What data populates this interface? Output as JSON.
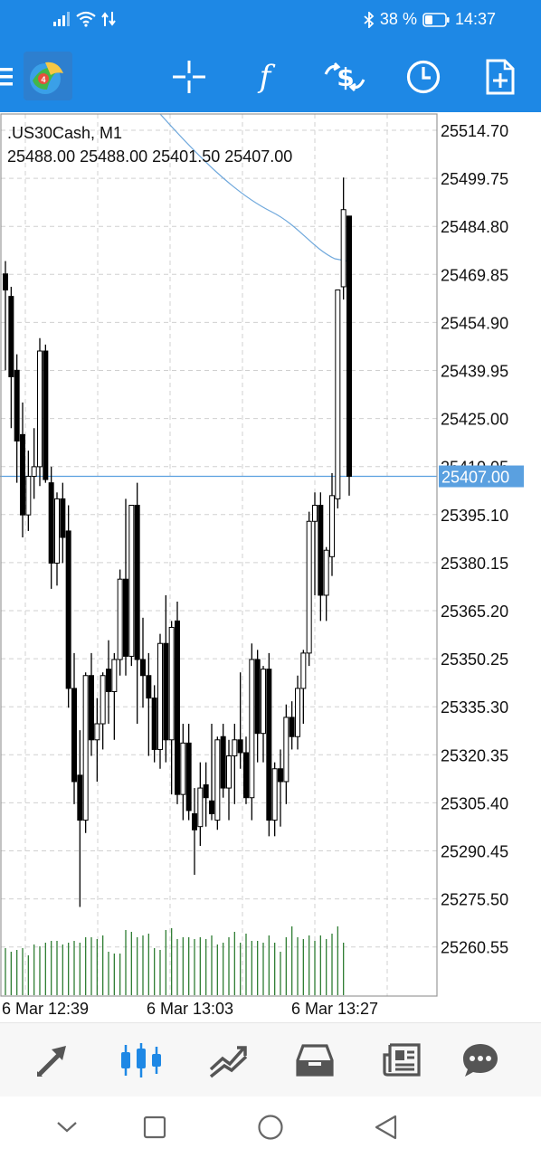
{
  "status_bar": {
    "battery_percent": "38 %",
    "battery_level": 0.38,
    "time": "14:37"
  },
  "toolbar": {
    "buttons": [
      {
        "name": "menu-icon"
      },
      {
        "name": "app-logo"
      },
      {
        "name": "crosshair-icon"
      },
      {
        "name": "indicators-icon"
      },
      {
        "name": "trade-icon"
      },
      {
        "name": "timeframe-clock-icon"
      },
      {
        "name": "new-object-icon"
      }
    ]
  },
  "chart": {
    "symbol_text": ".US30Cash, M1",
    "ohlc_text": "25488.00 25488.00 25401.50 25407.00",
    "current_price": "25407.00",
    "colors": {
      "grid": "#d0d0d0",
      "candle": "#000000",
      "volume": "#2e7d32",
      "price_line": "#5aa0e0",
      "ma_line": "#6fa8dc",
      "price_tag_bg": "#5aa0e0"
    }
  },
  "chart_data": {
    "type": "candlestick",
    "y_axis_ticks": [
      "25514.70",
      "25499.75",
      "25484.80",
      "25469.85",
      "25454.90",
      "25439.95",
      "25425.00",
      "25410.05",
      "25395.10",
      "25380.15",
      "25365.20",
      "25350.25",
      "25335.30",
      "25320.35",
      "25305.40",
      "25290.45",
      "25275.50",
      "25260.55"
    ],
    "x_axis_ticks": [
      "6 Mar 12:39",
      "6 Mar 13:03",
      "6 Mar 13:27"
    ],
    "ylim": [
      25254.0,
      25518.0
    ],
    "current_price": 25407.0,
    "grid": true,
    "candles": [
      [
        25470,
        25474,
        25440,
        25465
      ],
      [
        25463,
        25466,
        25422,
        25438
      ],
      [
        25440,
        25445,
        25405,
        25418
      ],
      [
        25420,
        25430,
        25388,
        25395
      ],
      [
        25395,
        25415,
        25390,
        25407
      ],
      [
        25407,
        25422,
        25400,
        25410
      ],
      [
        25410,
        25450,
        25404,
        25446
      ],
      [
        25446,
        25448,
        25405,
        25406
      ],
      [
        25405,
        25410,
        25372,
        25380
      ],
      [
        25380,
        25402,
        25373,
        25400
      ],
      [
        25400,
        25405,
        25380,
        25388
      ],
      [
        25390,
        25398,
        25335,
        25341
      ],
      [
        25341,
        25352,
        25305,
        25312
      ],
      [
        25314,
        25328,
        25273,
        25300
      ],
      [
        25300,
        25346,
        25296,
        25345
      ],
      [
        25345,
        25352,
        25320,
        25325
      ],
      [
        25325,
        25338,
        25312,
        25330
      ],
      [
        25330,
        25346,
        25322,
        25345
      ],
      [
        25347,
        25356,
        25330,
        25340
      ],
      [
        25340,
        25352,
        25325,
        25350
      ],
      [
        25350,
        25378,
        25345,
        25375
      ],
      [
        25375,
        25400,
        25345,
        25351
      ],
      [
        25351,
        25398,
        25348,
        25398
      ],
      [
        25398,
        25405,
        25330,
        25350
      ],
      [
        25350,
        25363,
        25335,
        25345
      ],
      [
        25345,
        25352,
        25320,
        25338
      ],
      [
        25338,
        25342,
        25318,
        25322
      ],
      [
        25322,
        25358,
        25316,
        25355
      ],
      [
        25355,
        25370,
        25318,
        25325
      ],
      [
        25325,
        25362,
        25308,
        25360
      ],
      [
        25362,
        25368,
        25305,
        25308
      ],
      [
        25308,
        25330,
        25300,
        25324
      ],
      [
        25324,
        25330,
        25300,
        25303
      ],
      [
        25302,
        25310,
        25283,
        25297
      ],
      [
        25298,
        25318,
        25292,
        25310
      ],
      [
        25311,
        25318,
        25298,
        25307
      ],
      [
        25306,
        25330,
        25300,
        25302
      ],
      [
        25300,
        25326,
        25297,
        25325
      ],
      [
        25326,
        25330,
        25307,
        25310
      ],
      [
        25310,
        25325,
        25300,
        25320
      ],
      [
        25320,
        25330,
        25305,
        25325
      ],
      [
        25325,
        25346,
        25316,
        25321
      ],
      [
        25321,
        25326,
        25305,
        25307
      ],
      [
        25307,
        25355,
        25300,
        25350
      ],
      [
        25350,
        25353,
        25318,
        25327
      ],
      [
        25327,
        25348,
        25318,
        25347
      ],
      [
        25347,
        25352,
        25295,
        25300
      ],
      [
        25300,
        25318,
        25295,
        25316
      ],
      [
        25316,
        25322,
        25298,
        25312
      ],
      [
        25312,
        25336,
        25305,
        25332
      ],
      [
        25332,
        25337,
        25322,
        25326
      ],
      [
        25326,
        25345,
        25322,
        25341
      ],
      [
        25341,
        25353,
        25330,
        25352
      ],
      [
        25352,
        25396,
        25348,
        25393
      ],
      [
        25393,
        25402,
        25370,
        25398
      ],
      [
        25398,
        25402,
        25362,
        25370
      ],
      [
        25370,
        25385,
        25362,
        25384
      ],
      [
        25382,
        25408,
        25376,
        25401
      ],
      [
        25400,
        25440,
        25397,
        25465
      ],
      [
        25466,
        25500,
        25462,
        25490
      ],
      [
        25488,
        25488,
        25401,
        25407
      ]
    ],
    "volumes": [
      26,
      24,
      25,
      26,
      22,
      28,
      27,
      29,
      30,
      30,
      28,
      29,
      30,
      29,
      32,
      32,
      31,
      33,
      24,
      23,
      23,
      36,
      35,
      32,
      33,
      34,
      26,
      25,
      36,
      37,
      31,
      32,
      32,
      31,
      32,
      31,
      33,
      28,
      29,
      32,
      35,
      29,
      34,
      30,
      30,
      29,
      33,
      29,
      24,
      32,
      38,
      32,
      31,
      33,
      30,
      33,
      31,
      34,
      38,
      29
    ]
  },
  "bottom_nav": {
    "items": [
      {
        "name": "quotes-tab",
        "active": false
      },
      {
        "name": "chart-tab",
        "active": true
      },
      {
        "name": "trade-tab",
        "active": false
      },
      {
        "name": "history-tab",
        "active": false
      },
      {
        "name": "news-tab",
        "active": false
      },
      {
        "name": "messages-tab",
        "active": false
      }
    ]
  }
}
